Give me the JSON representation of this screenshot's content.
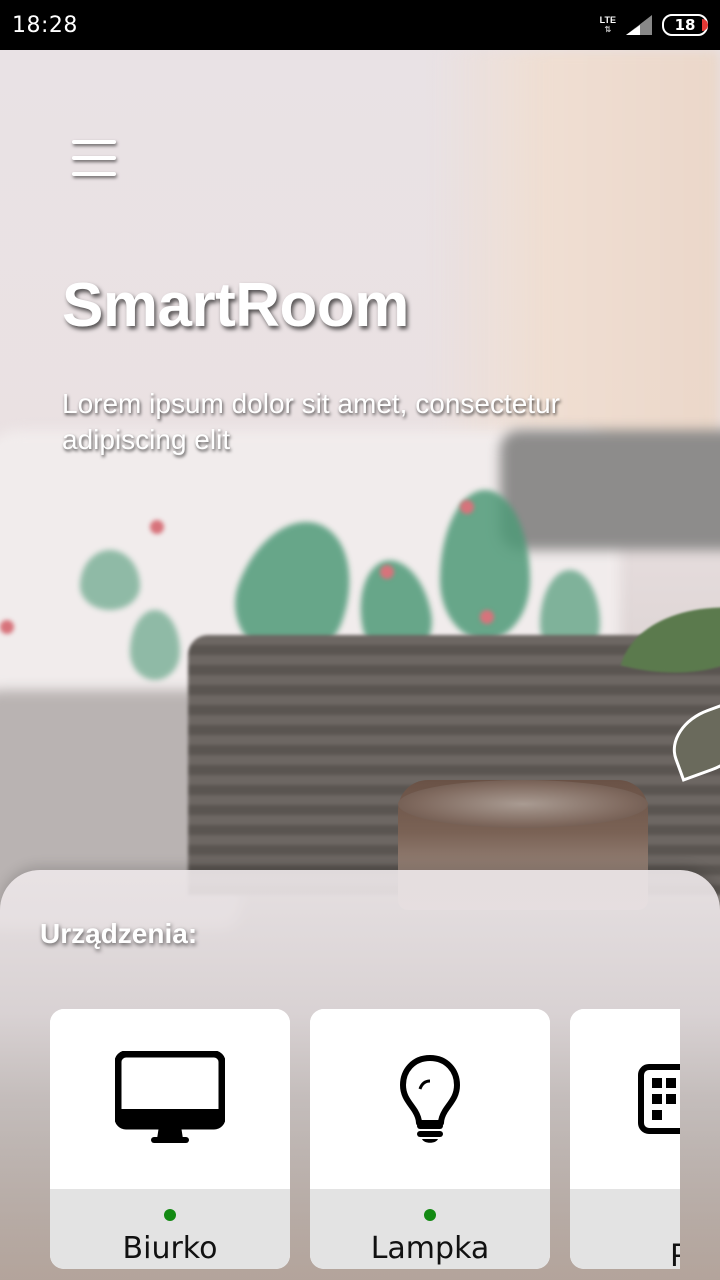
{
  "status_bar": {
    "time": "18:28",
    "network": "LTE",
    "battery": "18",
    "battery_color": "#e53935"
  },
  "header": {
    "menu_icon": "hamburger-menu-icon",
    "title": "SmartRoom",
    "subtitle": "Lorem ipsum dolor sit amet, consectetur adipiscing elit"
  },
  "devices": {
    "label": "Urządzenia:",
    "status_color": "#138a13",
    "items": [
      {
        "name": "Biurko",
        "icon": "monitor-icon",
        "active": true
      },
      {
        "name": "Lampka",
        "icon": "light-bulb-icon",
        "active": true
      },
      {
        "name": "P",
        "icon": "radiator-icon",
        "active": false
      }
    ]
  }
}
